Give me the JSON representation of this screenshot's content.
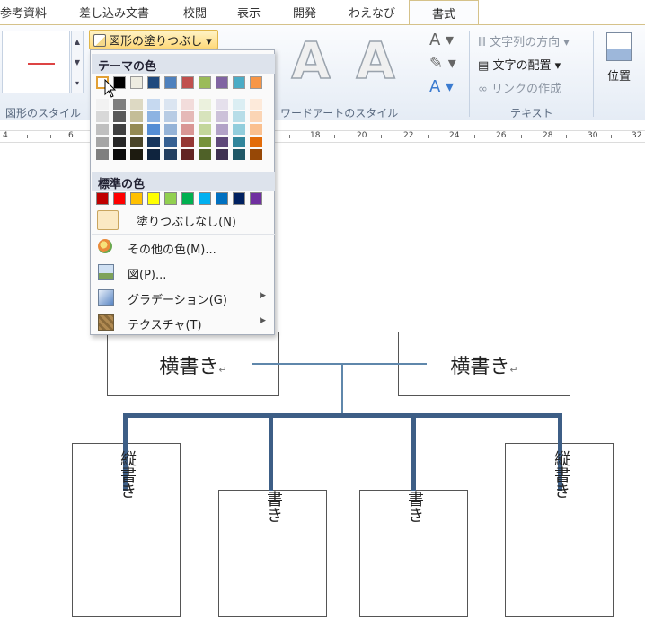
{
  "tabs": [
    "参考資料",
    "差し込み文書",
    "校閲",
    "表示",
    "開発",
    "わえなび",
    "書式"
  ],
  "ribbon": {
    "fill_button": "図形の塗りつぶし",
    "shape_style_label": "図形のスタイル",
    "wordart_label": "ワードアートのスタイル",
    "text_label": "テキスト",
    "wordart_letter": "A",
    "text_direction": "文字列の方向",
    "text_align": "文字の配置",
    "create_link": "リンクの作成",
    "position": "位置"
  },
  "ruler": {
    "numbers": [
      "4",
      "6",
      "18",
      "20",
      "22",
      "24",
      "26",
      "28",
      "30",
      "32"
    ]
  },
  "menu": {
    "theme_header": "テーマの色",
    "standard_header": "標準の色",
    "no_fill": "塗りつぶしなし(N)",
    "more_colors": "その他の色(M)...",
    "picture": "図(P)...",
    "gradient": "グラデーション(G)",
    "texture": "テクスチャ(T)",
    "theme_colors": [
      "#ffffff",
      "#000000",
      "#eeece1",
      "#1f497d",
      "#4f81bd",
      "#c0504d",
      "#9bbb59",
      "#8064a2",
      "#4bacc6",
      "#f79646"
    ],
    "theme_shades": [
      [
        "#f2f2f2",
        "#d8d8d8",
        "#bfbfbf",
        "#a5a5a5",
        "#7f7f7f"
      ],
      [
        "#7f7f7f",
        "#595959",
        "#3f3f3f",
        "#262626",
        "#0c0c0c"
      ],
      [
        "#ddd9c3",
        "#c4bd97",
        "#948a54",
        "#4a452a",
        "#1d1b10"
      ],
      [
        "#c6d9f0",
        "#8db3e2",
        "#548dd4",
        "#17365d",
        "#0f243e"
      ],
      [
        "#dbe5f1",
        "#b8cce4",
        "#95b3d7",
        "#366092",
        "#244061"
      ],
      [
        "#f2dcdb",
        "#e5b9b7",
        "#d99694",
        "#953734",
        "#632423"
      ],
      [
        "#ebf1dd",
        "#d7e3bc",
        "#c3d69b",
        "#76923c",
        "#4f6128"
      ],
      [
        "#e5e0ec",
        "#ccc1d9",
        "#b2a2c7",
        "#5f497a",
        "#3f3151"
      ],
      [
        "#dbeef3",
        "#b7dde8",
        "#92cddc",
        "#31859b",
        "#205867"
      ],
      [
        "#fdeada",
        "#fbd5b5",
        "#fac08f",
        "#e36c09",
        "#974806"
      ]
    ],
    "standard_colors": [
      "#c00000",
      "#ff0000",
      "#ffc000",
      "#ffff00",
      "#92d050",
      "#00b050",
      "#00b0f0",
      "#0070c0",
      "#002060",
      "#7030a0"
    ]
  },
  "document": {
    "top_box_left": "横書き",
    "top_box_right": "横書き",
    "box1_text": "縦書き",
    "box2_text": "書き",
    "box3_text": "書き",
    "box4_text": "縦書き",
    "return_mark": "↵"
  }
}
